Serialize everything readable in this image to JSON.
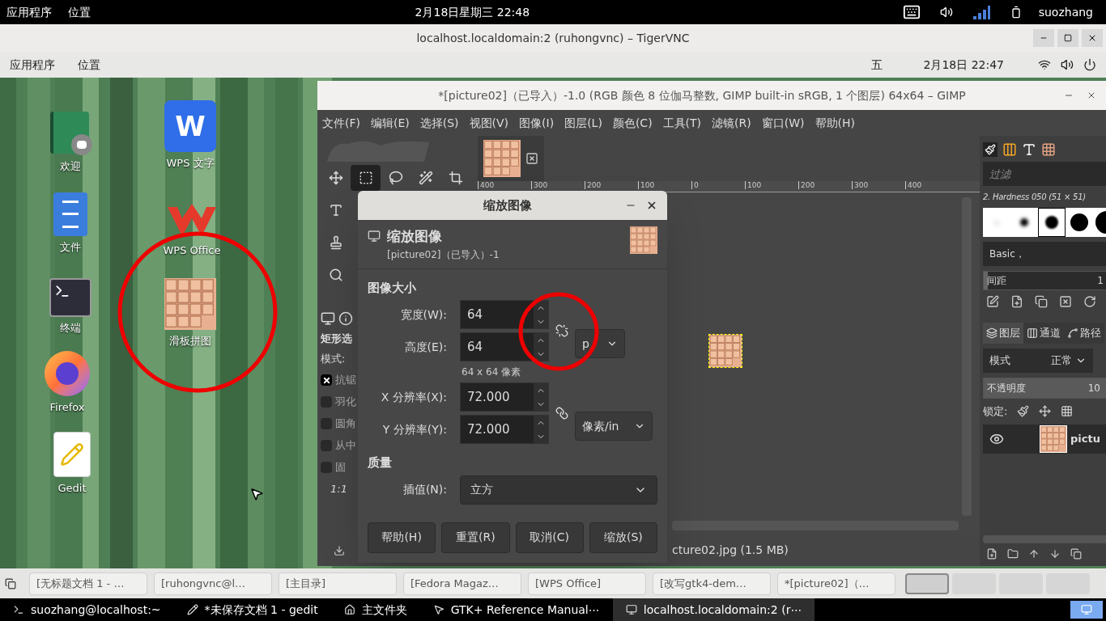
{
  "top_bar": {
    "menus": [
      "应用程序",
      "位置"
    ],
    "clock": "2月18日星期三 22:48",
    "user": "suozhang"
  },
  "vnc_window": {
    "title": "localhost.localdomain:2 (ruhongvnc) – TigerVNC"
  },
  "remote_top_bar": {
    "menus": [
      "应用程序",
      "位置"
    ],
    "weekday": "五",
    "clock": "2月18日 22:47"
  },
  "desktop_icons": [
    {
      "label": "欢迎",
      "kind": "welcome"
    },
    {
      "label": "文件",
      "kind": "files"
    },
    {
      "label": "终端",
      "kind": "terminal"
    },
    {
      "label": "Firefox",
      "kind": "firefox"
    },
    {
      "label": "Gedit",
      "kind": "gedit"
    },
    {
      "label": "WPS 文字",
      "kind": "wps_writer",
      "badge": "W"
    },
    {
      "label": "WPS Office",
      "kind": "wps"
    },
    {
      "label": "滑板拼图",
      "kind": "puzzle"
    }
  ],
  "gimp": {
    "title": "*[picture02]（已导入）-1.0 (RGB 颜色 8 位伽马整数, GIMP built-in sRGB, 1 个图层) 64x64 – GIMP",
    "menus": [
      "文件(F)",
      "编辑(E)",
      "选择(S)",
      "视图(V)",
      "图像(I)",
      "图层(L)",
      "颜色(C)",
      "工具(T)",
      "滤镜(R)",
      "窗口(W)",
      "帮助(H)"
    ],
    "tool_options": {
      "title": "矩形选",
      "mode_label": "模式:",
      "options": [
        {
          "label": "抗锯",
          "checked": true
        },
        {
          "label": "羽化",
          "checked": false
        },
        {
          "label": "圆角",
          "checked": false
        },
        {
          "label": "从中",
          "checked": false
        },
        {
          "label": "固",
          "checked": false
        }
      ],
      "ratio": "1:1"
    },
    "ruler": [
      "400",
      "300",
      "200",
      "100",
      "0",
      "100",
      "200",
      "300",
      "400"
    ],
    "status": "cture02.jpg (1.5 MB)",
    "dock": {
      "filter_placeholder": "过滤",
      "brush_name": "2. Hardness 050 (51 × 51)",
      "brushes": [
        {
          "selected": false
        },
        {
          "selected": false
        },
        {
          "selected": true
        },
        {
          "selected": false
        },
        {
          "selected": false
        }
      ],
      "tag": "Basic，",
      "spacing": {
        "label": "间距",
        "reading": "1",
        "level": 0.03
      },
      "tabs": [
        {
          "label": "图层",
          "selected": true
        },
        {
          "label": "通道",
          "selected": false
        },
        {
          "label": "路径",
          "selected": false
        }
      ],
      "mode_label": "模式",
      "mode_value": "正常",
      "opacity": {
        "label": "不透明度",
        "reading": "10",
        "level": 1
      },
      "lock_label": "锁定:",
      "layers": [
        {
          "name": "pictu",
          "visible": true
        }
      ]
    }
  },
  "dialog": {
    "title": "缩放图像",
    "heading": "缩放图像",
    "subtitle": "[picture02]（已导入）-1",
    "size_section": "图像大小",
    "width": {
      "label": "宽度(W):",
      "value": "64"
    },
    "height": {
      "label": "高度(E):",
      "value": "64"
    },
    "size_chain_linked": false,
    "size_unit": "p",
    "size_info": "64 x 64 像素",
    "xres": {
      "label": "X 分辨率(X):",
      "value": "72.000"
    },
    "yres": {
      "label": "Y 分辨率(Y):",
      "value": "72.000"
    },
    "res_chain_linked": true,
    "res_unit": "像素/in",
    "quality_section": "质量",
    "interp_label": "插值(N):",
    "interp_value": "立方",
    "buttons": [
      "帮助(H)",
      "重置(R)",
      "取消(C)",
      "缩放(S)"
    ]
  },
  "taskbar": {
    "tasks": [
      "[无标题文档 1 - …",
      "[ruhongvnc@l…",
      "[主目录]",
      "[Fedora Magaz…",
      "[WPS Office]",
      "[改写gtk4-dem…",
      "*[picture02]（…"
    ],
    "workspaces": [
      {
        "selected": true
      },
      {
        "selected": false
      },
      {
        "selected": false
      },
      {
        "selected": false
      }
    ]
  },
  "bottom_bar": {
    "tasks": [
      {
        "label": "suozhang@localhost:~",
        "selected": false
      },
      {
        "label": "*未保存文档 1 - gedit",
        "selected": false
      },
      {
        "label": "主文件夹",
        "selected": false
      },
      {
        "label": "GTK+ Reference Manual⋯",
        "selected": false
      },
      {
        "label": "localhost.localdomain:2 (r⋯",
        "selected": true
      }
    ],
    "show_desktop": {
      "selected": true
    }
  }
}
